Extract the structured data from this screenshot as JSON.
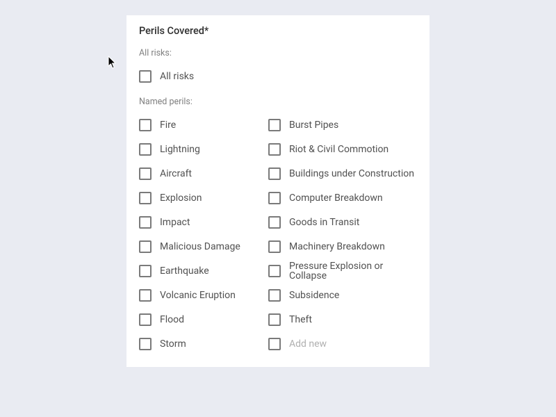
{
  "card": {
    "title": "Perils Covered*",
    "all_risks_header": "All risks:",
    "all_risks_label": "All risks",
    "named_header": "Named perils:",
    "left": [
      "Fire",
      "Lightning",
      "Aircraft",
      "Explosion",
      "Impact",
      "Malicious Damage",
      "Earthquake",
      "Volcanic Eruption",
      "Flood",
      "Storm"
    ],
    "right": [
      "Burst Pipes",
      "Riot & Civil Commotion",
      "Buildings under Construction",
      "Computer Breakdown",
      "Goods in Transit",
      "Machinery Breakdown",
      "Pressure Explosion or Collapse",
      "Subsidence",
      "Theft"
    ],
    "add_new": "Add new"
  }
}
